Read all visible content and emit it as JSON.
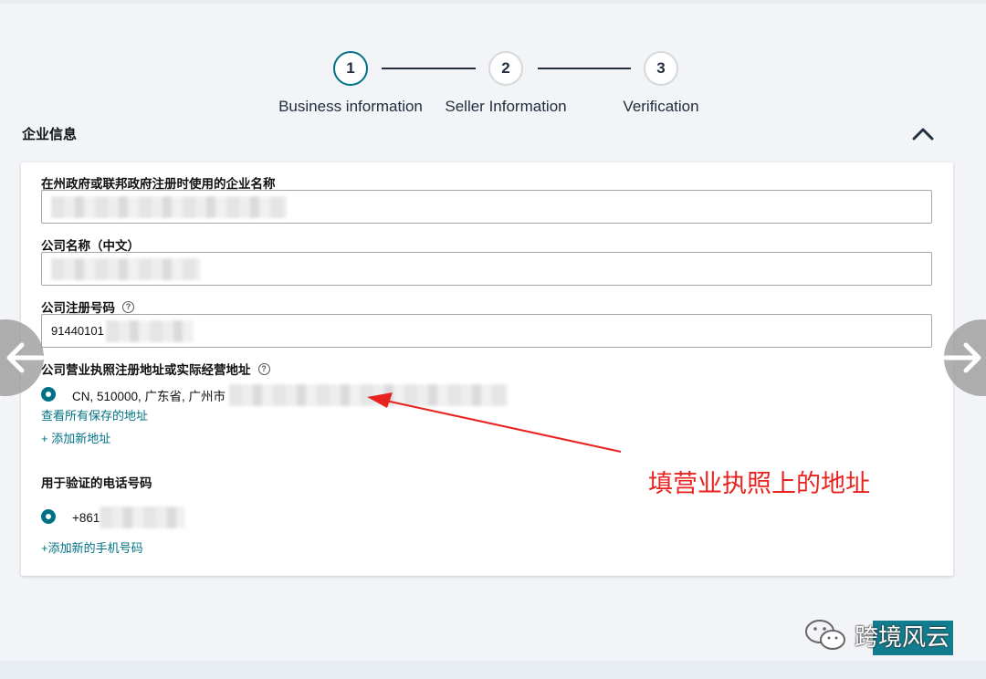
{
  "stepper": {
    "steps": [
      {
        "number": "1",
        "label": "Business information"
      },
      {
        "number": "2",
        "label": "Seller Information"
      },
      {
        "number": "3",
        "label": "Verification"
      }
    ]
  },
  "section": {
    "title": "企业信息"
  },
  "form": {
    "business_name_label": "在州政府或联邦政府注册时使用的企业名称",
    "company_name_cn_label": "公司名称（中文）",
    "registration_number_label": "公司注册号码",
    "registration_number_value": "91440101",
    "address_label": "公司营业执照注册地址或实际经营地址",
    "address_value": "CN, 510000, 广东省, 广州市",
    "view_saved_addresses": "查看所有保存的地址",
    "add_new_address": "+ 添加新地址",
    "phone_label": "用于验证的电话号码",
    "phone_value": "+861",
    "add_new_phone": "+添加新的手机号码",
    "help_glyph": "?"
  },
  "annotation": {
    "text": "填营业执照上的地址",
    "color": "#e8231f"
  },
  "watermark": {
    "text": "跨境风云"
  },
  "colors": {
    "accent": "#007185",
    "text": "#0f1111",
    "step_dark": "#232f3e"
  }
}
